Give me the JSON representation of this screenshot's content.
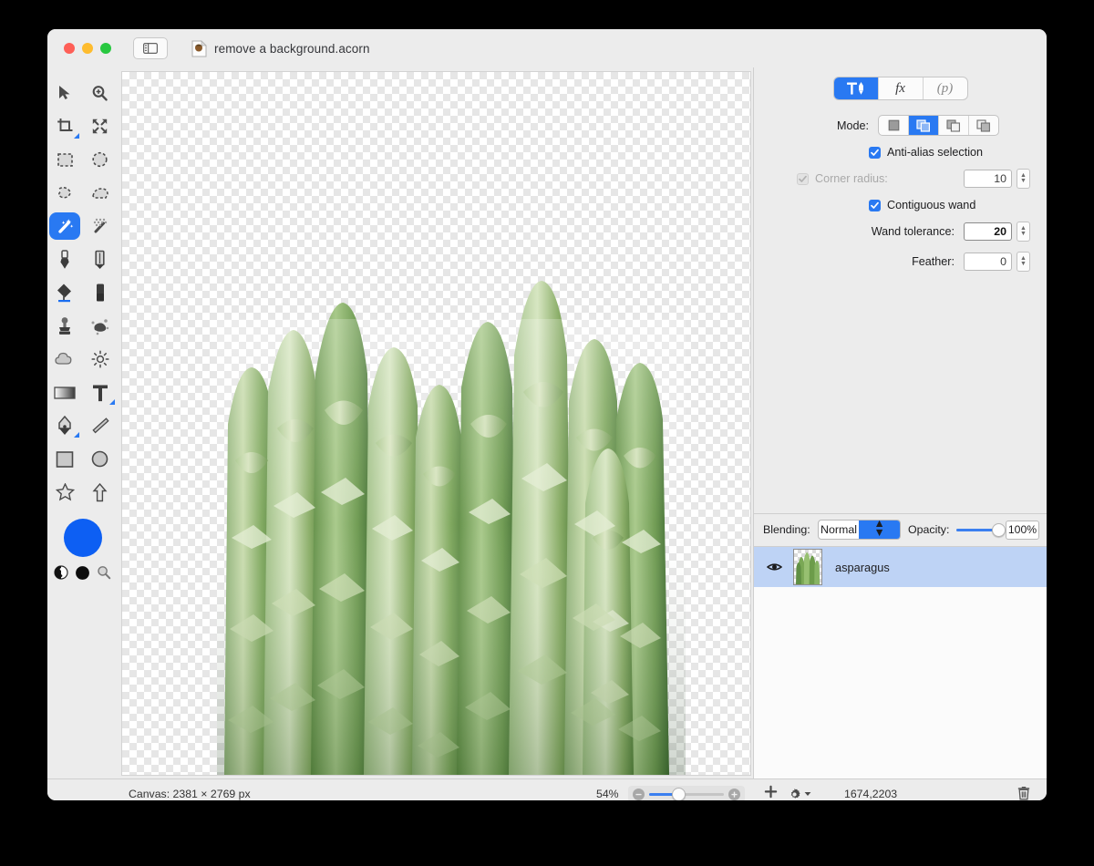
{
  "window": {
    "title": "remove a background.acorn",
    "traffic_lights": [
      "close",
      "minimize",
      "maximize"
    ],
    "sidebar_toggle_icon": "sidebar-toggle-icon",
    "doc_icon": "acorn-document-icon"
  },
  "tools": {
    "rows": [
      [
        {
          "name": "move-tool",
          "icon": "arrow-cursor-icon",
          "selected": false,
          "submenu": false
        },
        {
          "name": "zoom-tool",
          "icon": "magnifier-plus-icon",
          "selected": false,
          "submenu": false
        }
      ],
      [
        {
          "name": "crop-tool",
          "icon": "crop-icon",
          "selected": false,
          "submenu": true
        },
        {
          "name": "transform-tool",
          "icon": "four-arrows-icon",
          "selected": false,
          "submenu": false
        }
      ],
      [
        {
          "name": "rectangular-selection-tool",
          "icon": "dashed-rectangle-icon",
          "selected": false,
          "submenu": false
        },
        {
          "name": "elliptical-selection-tool",
          "icon": "dashed-ellipse-icon",
          "selected": false,
          "submenu": false
        }
      ],
      [
        {
          "name": "lasso-tool",
          "icon": "lasso-icon",
          "selected": false,
          "submenu": false
        },
        {
          "name": "polygon-lasso-tool",
          "icon": "polygon-lasso-icon",
          "selected": false,
          "submenu": false
        }
      ],
      [
        {
          "name": "magic-wand-tool",
          "icon": "magic-wand-icon",
          "selected": true,
          "submenu": false
        },
        {
          "name": "instant-alpha-tool",
          "icon": "magic-wand-dots-icon",
          "selected": false,
          "submenu": false
        }
      ],
      [
        {
          "name": "brush-tool",
          "icon": "paint-brush-icon",
          "selected": false,
          "submenu": false
        },
        {
          "name": "pencil-tool",
          "icon": "pencil-icon",
          "selected": false,
          "submenu": false
        }
      ],
      [
        {
          "name": "paint-bucket-tool",
          "icon": "paint-bucket-icon",
          "selected": false,
          "submenu": false
        },
        {
          "name": "eraser-tool",
          "icon": "eraser-icon",
          "selected": false,
          "submenu": false
        }
      ],
      [
        {
          "name": "clone-stamp-tool",
          "icon": "clone-stamp-icon",
          "selected": false,
          "submenu": false
        },
        {
          "name": "smudge-tool",
          "icon": "smudge-splatter-icon",
          "selected": false,
          "submenu": false
        }
      ],
      [
        {
          "name": "blur-tool",
          "icon": "cloud-icon",
          "selected": false,
          "submenu": false
        },
        {
          "name": "dodge-burn-tool",
          "icon": "sun-icon",
          "selected": false,
          "submenu": false
        }
      ],
      [
        {
          "name": "gradient-tool",
          "icon": "gradient-icon",
          "selected": false,
          "submenu": false
        },
        {
          "name": "text-tool",
          "icon": "text-t-icon",
          "selected": false,
          "submenu": true
        }
      ],
      [
        {
          "name": "bezier-pen-tool",
          "icon": "pen-nib-icon",
          "selected": false,
          "submenu": true
        },
        {
          "name": "line-tool",
          "icon": "diagonal-line-icon",
          "selected": false,
          "submenu": false
        }
      ],
      [
        {
          "name": "rectangle-shape-tool",
          "icon": "square-icon",
          "selected": false,
          "submenu": false
        },
        {
          "name": "ellipse-shape-tool",
          "icon": "circle-icon",
          "selected": false,
          "submenu": false
        }
      ],
      [
        {
          "name": "star-shape-tool",
          "icon": "star-icon",
          "selected": false,
          "submenu": false
        },
        {
          "name": "arrow-shape-tool",
          "icon": "up-arrow-icon",
          "selected": false,
          "submenu": false
        }
      ]
    ],
    "foreground_color": "#0d5ff3",
    "bottom_swatches": [
      {
        "name": "swap-colors-swatch",
        "icon": "half-filled-circle-icon"
      },
      {
        "name": "background-color-swatch",
        "icon": "black-circle-icon"
      },
      {
        "name": "color-picker-loupe",
        "icon": "magnifier-icon"
      }
    ]
  },
  "inspector": {
    "tabs": [
      {
        "label": "",
        "name": "tab-tool-options",
        "icon": "hammer-pen-icon",
        "selected": true
      },
      {
        "label": "fx",
        "name": "tab-filters",
        "icon": "fx-icon",
        "selected": false
      },
      {
        "label": "(p)",
        "name": "tab-palettes",
        "icon": "palette-p-icon",
        "selected": false
      }
    ],
    "mode_label": "Mode:",
    "mode_buttons": [
      {
        "name": "mode-new-selection",
        "icon": "single-square-icon",
        "selected": false
      },
      {
        "name": "mode-add-selection",
        "icon": "add-squares-icon",
        "selected": true
      },
      {
        "name": "mode-subtract-selection",
        "icon": "subtract-squares-icon",
        "selected": false
      },
      {
        "name": "mode-intersect-selection",
        "icon": "intersect-squares-icon",
        "selected": false
      }
    ],
    "antialias": {
      "label": "Anti-alias selection",
      "checked": true,
      "enabled": true
    },
    "corner_radius": {
      "label": "Corner radius:",
      "checked": true,
      "enabled": false,
      "value": "10"
    },
    "contiguous": {
      "label": "Contiguous wand",
      "checked": true,
      "enabled": true
    },
    "wand_tolerance": {
      "label": "Wand tolerance:",
      "value": "20"
    },
    "feather": {
      "label": "Feather:",
      "value": "0"
    }
  },
  "layers_panel": {
    "blending_label": "Blending:",
    "blending_value": "Normal",
    "opacity_label": "Opacity:",
    "opacity_value": "100%",
    "opacity_percent": 100,
    "layers": [
      {
        "name": "asparagus",
        "visible": true,
        "selected": true
      }
    ]
  },
  "statusbar": {
    "canvas_size": "Canvas: 2381 × 2769 px",
    "zoom_level": "54%",
    "zoom_slider_percent": 35,
    "zoom_out_icon": "minus-circle-icon",
    "zoom_in_icon": "plus-circle-icon",
    "add_layer_icon": "plus-icon",
    "actions_gear_icon": "gear-icon",
    "coordinates": "1674,2203",
    "delete_icon": "trash-icon"
  }
}
